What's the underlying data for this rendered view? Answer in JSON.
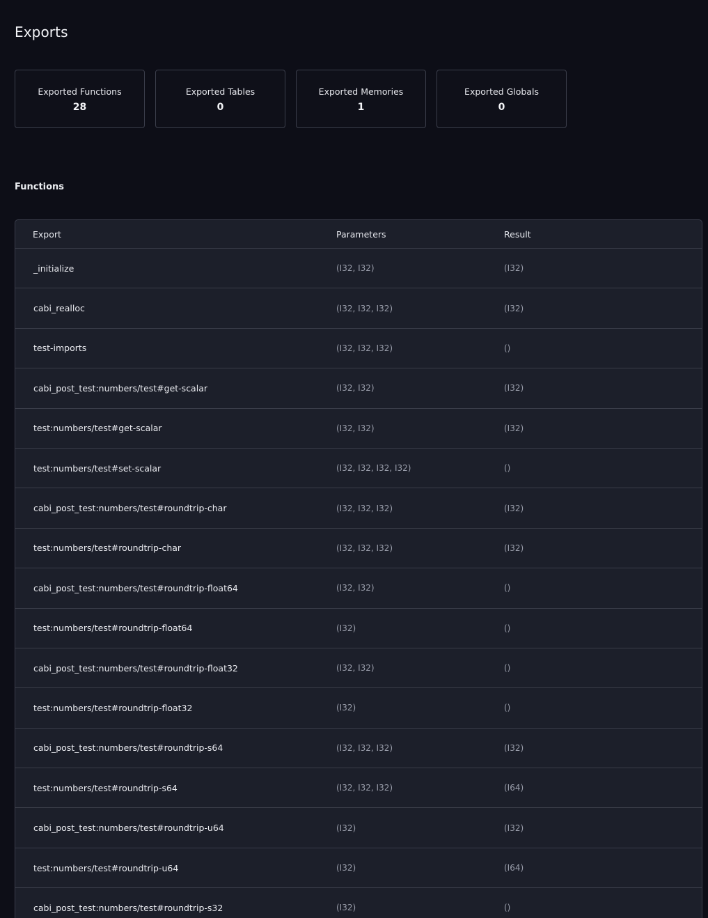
{
  "page": {
    "title": "Exports"
  },
  "stats": [
    {
      "label": "Exported Functions",
      "value": "28"
    },
    {
      "label": "Exported Tables",
      "value": "0"
    },
    {
      "label": "Exported Memories",
      "value": "1"
    },
    {
      "label": "Exported Globals",
      "value": "0"
    }
  ],
  "functions": {
    "title": "Functions",
    "columns": {
      "export": "Export",
      "parameters": "Parameters",
      "result": "Result"
    },
    "rows": [
      {
        "export": "_initialize",
        "parameters": "(I32, I32)",
        "result": "(I32)"
      },
      {
        "export": "cabi_realloc",
        "parameters": "(I32, I32, I32)",
        "result": "(I32)"
      },
      {
        "export": "test-imports",
        "parameters": "(I32, I32, I32)",
        "result": "()"
      },
      {
        "export": "cabi_post_test:numbers/test#get-scalar",
        "parameters": "(I32, I32)",
        "result": "(I32)"
      },
      {
        "export": "test:numbers/test#get-scalar",
        "parameters": "(I32, I32)",
        "result": "(I32)"
      },
      {
        "export": "test:numbers/test#set-scalar",
        "parameters": "(I32, I32, I32, I32)",
        "result": "()"
      },
      {
        "export": "cabi_post_test:numbers/test#roundtrip-char",
        "parameters": "(I32, I32, I32)",
        "result": "(I32)"
      },
      {
        "export": "test:numbers/test#roundtrip-char",
        "parameters": "(I32, I32, I32)",
        "result": "(I32)"
      },
      {
        "export": "cabi_post_test:numbers/test#roundtrip-float64",
        "parameters": "(I32, I32)",
        "result": "()"
      },
      {
        "export": "test:numbers/test#roundtrip-float64",
        "parameters": "(I32)",
        "result": "()"
      },
      {
        "export": "cabi_post_test:numbers/test#roundtrip-float32",
        "parameters": "(I32, I32)",
        "result": "()"
      },
      {
        "export": "test:numbers/test#roundtrip-float32",
        "parameters": "(I32)",
        "result": "()"
      },
      {
        "export": "cabi_post_test:numbers/test#roundtrip-s64",
        "parameters": "(I32, I32, I32)",
        "result": "(I32)"
      },
      {
        "export": "test:numbers/test#roundtrip-s64",
        "parameters": "(I32, I32, I32)",
        "result": "(I64)"
      },
      {
        "export": "cabi_post_test:numbers/test#roundtrip-u64",
        "parameters": "(I32)",
        "result": "(I32)"
      },
      {
        "export": "test:numbers/test#roundtrip-u64",
        "parameters": "(I32)",
        "result": "(I64)"
      },
      {
        "export": "cabi_post_test:numbers/test#roundtrip-s32",
        "parameters": "(I32)",
        "result": "()"
      }
    ]
  }
}
